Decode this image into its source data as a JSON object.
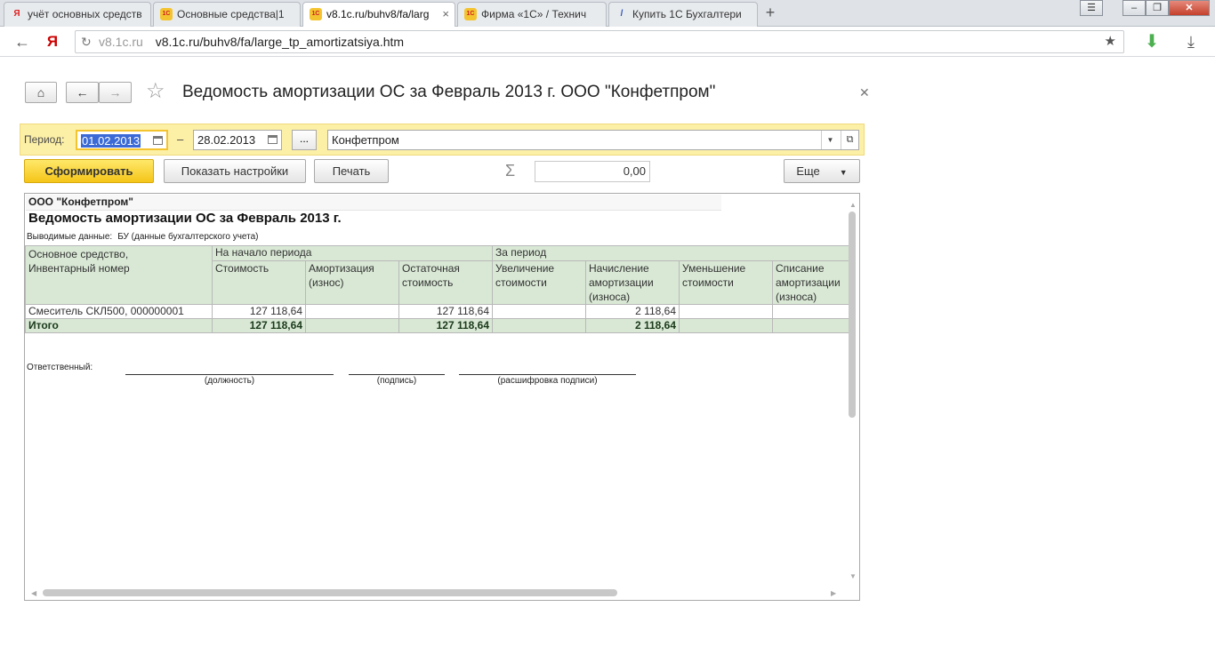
{
  "browser": {
    "tabs": [
      {
        "label": "учёт основных средств",
        "favicon": "Я",
        "active": false
      },
      {
        "label": "Основные средства|1",
        "favicon": "1C",
        "active": false
      },
      {
        "label": "v8.1c.ru/buhv8/fa/larg",
        "favicon": "1C",
        "active": true
      },
      {
        "label": "Фирма «1С» / Технич",
        "favicon": "1C",
        "active": false
      },
      {
        "label": "Купить 1С Бухгалтери",
        "favicon": "/",
        "active": false
      }
    ],
    "address": {
      "host": "v8.1c.ru",
      "url": "v8.1c.ru/buhv8/fa/large_tp_amortizatsiya.htm"
    }
  },
  "form": {
    "title": "Ведомость амортизации ОС за Февраль 2013 г. ООО \"Конфетпром\"",
    "period_label": "Период:",
    "date_from": "01.02.2013",
    "date_to": "28.02.2013",
    "dash": "–",
    "dots": "...",
    "organization": "Конфетпром",
    "buttons": {
      "generate": "Сформировать",
      "settings": "Показать настройки",
      "print": "Печать",
      "more": "Еще"
    },
    "sum_symbol": "Σ",
    "sum_value": "0,00"
  },
  "report": {
    "org": "ООО \"Конфетпром\"",
    "title": "Ведомость амортизации ОС за Февраль 2013 г.",
    "output_label": "Выводимые данные:",
    "output_value": "БУ (данные бухгалтерского учета)",
    "group_headers": {
      "asset": "Основное средство,",
      "asset2": "Инвентарный номер",
      "start": "На начало периода",
      "period": "За период"
    },
    "columns": [
      [
        "Стоимость"
      ],
      [
        "Амортизация",
        "(износ)"
      ],
      [
        "Остаточная",
        "стоимость"
      ],
      [
        "Увеличение",
        "стоимости"
      ],
      [
        "Начисление",
        "амортизации",
        "(износа)"
      ],
      [
        "Уменьшение",
        "стоимости"
      ],
      [
        "Списание",
        "амортизации",
        "(износа)"
      ]
    ],
    "row": {
      "asset": "Смеситель СКЛ500, 000000001",
      "values": [
        "127 118,64",
        "",
        "127 118,64",
        "",
        "2 118,64",
        "",
        ""
      ]
    },
    "total": {
      "label": "Итого",
      "values": [
        "127 118,64",
        "",
        "127 118,64",
        "",
        "2 118,64",
        "",
        ""
      ]
    },
    "signature": {
      "label": "Ответственный:",
      "position": "(должность)",
      "sign": "(подпись)",
      "decoding": "(расшифровка подписи)"
    }
  }
}
